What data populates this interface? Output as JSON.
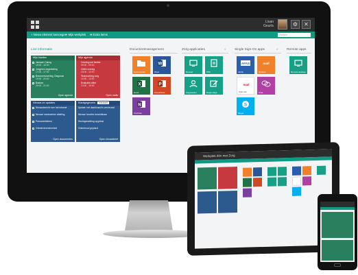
{
  "colors": {
    "accent": "#0f9a83",
    "topbar": "#2d2d2d",
    "green_widget": "#29805f",
    "red_widget": "#c5393f",
    "blue_widget": "#2c5a8f",
    "orange": "#f0802a",
    "blue_tile": "#2b5fad",
    "word": "#2b579a",
    "excel": "#217346",
    "powerpoint": "#d24726",
    "onenote": "#7b3fa0",
    "teal_tile": "#16a085",
    "red_tile": "#e0343a",
    "purple_tile": "#b13fa4",
    "skype": "#00aff0"
  },
  "monitor": {
    "topbar": {
      "logo_icon": "app-grid-icon",
      "user_name": "Lisan\nGeurts",
      "icons": [
        "settings-icon",
        "close-icon"
      ]
    },
    "greenbar": {
      "items": [
        "+ Nieuw element toevoegen",
        "✦ Mijn werkplek",
        "☰ Extra items"
      ],
      "search_placeholder": "Zoeken"
    },
    "sections": {
      "left": "Live informatie",
      "docs": "Documentmanagement",
      "apps": "Zorg applicaties",
      "sso": "Single Sign-On apps",
      "remote": "Remote apps"
    },
    "green_widget": {
      "title": "Mijn klanten",
      "rows": [
        {
          "name": "Janssen Caring",
          "sub": "16:00 - 16:30"
        },
        {
          "name": "Jongeren begeleiding",
          "sub": "17:00 - 17:30"
        },
        {
          "name": "Bewonersoverleg, Diagnose",
          "sub": "19:00 - 20:00"
        },
        {
          "name": "Brakton",
          "sub": "20:00 - 21:00"
        }
      ],
      "footer": "Open agenda"
    },
    "red_widget": {
      "title": "Mijn agenda",
      "rows": [
        {
          "name": "Overleg met familie",
          "sub": "09:00 - 09:30"
        },
        {
          "name": "Cliënt overleg",
          "sub": "10:00 - 10:30"
        },
        {
          "name": "Teamoverleg zorg",
          "sub": "12:00 - 13:00"
        },
        {
          "name": "Evaluatie cliënt",
          "sub": "14:00 - 15:00"
        }
      ],
      "footer": "Open mails"
    },
    "blue_widget_left": {
      "title": "Nieuws en updates",
      "rows": [
        {
          "name": "Nieuwsbericht over het intranet",
          "sub": ""
        },
        {
          "name": "Nieuwe medewerker afdeling",
          "sub": ""
        },
        {
          "name": "Personeelsfeest",
          "sub": ""
        },
        {
          "name": "Cliententevredenheid",
          "sub": ""
        }
      ],
      "footer": "Open documenten"
    },
    "blue_widget_right": {
      "title": "Klantgegevens",
      "tab": "Intranet",
      "rows": [
        {
          "name": "Update: het dashboard is vernieuwd",
          "sub": ""
        },
        {
          "name": "Nieuwe functies beschikbaar",
          "sub": ""
        },
        {
          "name": "Storingsmelding opgelost",
          "sub": ""
        },
        {
          "name": "Onderhoud gepland",
          "sub": ""
        }
      ],
      "footer": "Open nieuwsbrief"
    },
    "doc_tiles": [
      {
        "label": "Documenten",
        "color": "#f0802a",
        "icon": "folder-icon"
      },
      {
        "label": "Word",
        "color": "#2b579a",
        "icon": "word-icon"
      },
      {
        "label": "Excel",
        "color": "#217346",
        "icon": "excel-icon"
      },
      {
        "label": "PowerPoint",
        "color": "#d24726",
        "icon": "powerpoint-icon"
      },
      {
        "label": "OneNote",
        "color": "#7b3fa0",
        "icon": "onenote-icon"
      }
    ],
    "app_tiles": [
      {
        "label": "Rooster",
        "color": "#16a085",
        "icon": "desktop-icon"
      },
      {
        "label": "PDF",
        "color": "#16a085",
        "icon": "pdf-icon"
      },
      {
        "label": "Zorgdossier",
        "color": "#16a085",
        "icon": "user-icon"
      },
      {
        "label": "Rapportage",
        "color": "#16a085",
        "icon": "edit-icon"
      }
    ],
    "sso_tiles": [
      {
        "label": "AFAS",
        "color": "#2b5fad",
        "icon": "afas-icon"
      },
      {
        "label": "Outlook",
        "color": "#f0802a",
        "icon": "outlook-icon"
      },
      {
        "label": "Webmail",
        "color": "#ffffff",
        "icon": "webmail-icon"
      },
      {
        "label": "Chat",
        "color": "#b13fa4",
        "icon": "chat-icon"
      },
      {
        "label": "Skype",
        "color": "#00aff0",
        "icon": "skype-icon"
      }
    ],
    "remote_tiles": [
      {
        "label": "Remote desktop",
        "color": "#16a085",
        "icon": "remote-desktop-icon"
      }
    ]
  },
  "tablet": {
    "title": "Werkplek één met Zorg"
  }
}
